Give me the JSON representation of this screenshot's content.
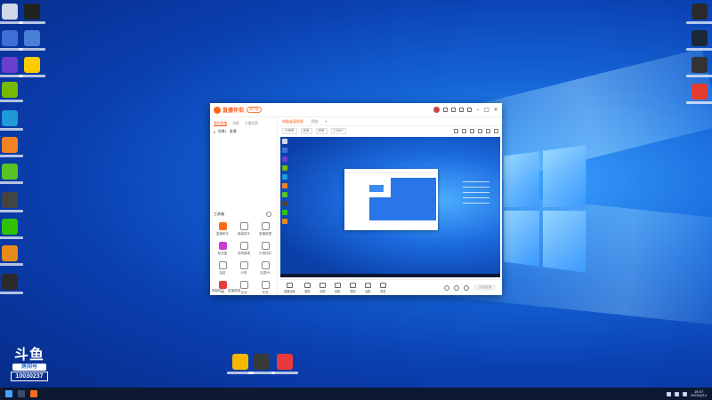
{
  "desktop": {
    "left_icons": [
      {
        "icon": "recycle-bin-icon",
        "color": "#cfd8e6"
      },
      {
        "icon": "control-panel-icon",
        "color": "#3f6fd6"
      },
      {
        "icon": "app-icon",
        "color": "#6a3fd0"
      },
      {
        "icon": "nvidia-icon",
        "color": "#76b900"
      },
      {
        "icon": "edge-icon",
        "color": "#1e9ad6"
      },
      {
        "icon": "app-icon",
        "color": "#f58220"
      },
      {
        "icon": "app-icon",
        "color": "#58c322"
      },
      {
        "icon": "app-icon",
        "color": "#444444"
      },
      {
        "icon": "wechat-icon",
        "color": "#2dc100"
      },
      {
        "icon": "app-icon",
        "color": "#e88a1a"
      },
      {
        "icon": "app-icon",
        "color": "#2a2a2a"
      }
    ],
    "second_col_icons": [
      {
        "icon": "app-icon",
        "color": "#222222"
      },
      {
        "icon": "app-icon",
        "color": "#4a7fd8"
      },
      {
        "icon": "app-icon",
        "color": "#ffcc00"
      }
    ],
    "right_icons": [
      {
        "icon": "epic-games-icon",
        "color": "#2a2a2a"
      },
      {
        "icon": "steam-icon",
        "color": "#1b2838"
      },
      {
        "icon": "app-icon",
        "color": "#333333"
      },
      {
        "icon": "app-icon",
        "color": "#e43c2f"
      }
    ],
    "bottom_icons": [
      {
        "icon": "app-icon",
        "color": "#f5b800"
      },
      {
        "icon": "app-icon",
        "color": "#3a3a3a"
      },
      {
        "icon": "app-icon",
        "color": "#e83a3a"
      }
    ]
  },
  "douyu": {
    "big": "斗鱼",
    "sub": "房间号",
    "room": "10030237"
  },
  "app": {
    "name": "直播伴侣",
    "version": "官方版",
    "sidebar_tabs": [
      "我的直播",
      "场景",
      "开播设置"
    ],
    "scene_label": "场景1",
    "scene_item": "直播",
    "tools_title": "工具箱",
    "tools": [
      {
        "label": "直播助手",
        "color": "#ff6a1a"
      },
      {
        "label": "弹幕助手",
        "color": "#888888"
      },
      {
        "label": "直播数据",
        "color": "#888888"
      },
      {
        "label": "粉丝团",
        "color": "#c53fd0"
      },
      {
        "label": "房间管理",
        "color": "#888888"
      },
      {
        "label": "礼物特效",
        "color": "#888888"
      },
      {
        "label": "抽奖",
        "color": "#888888"
      },
      {
        "label": "分享",
        "color": "#888888"
      },
      {
        "label": "连麦PK",
        "color": "#888888"
      },
      {
        "label": "PK",
        "color": "#e23c3c"
      },
      {
        "label": "互动",
        "color": "#888888"
      },
      {
        "label": "任务",
        "color": "#888888"
      }
    ],
    "footer_left": "弹幕助手",
    "footer_right": "直播数据",
    "main_tabs": [
      "电脑桌面投屏",
      "添加"
    ],
    "info_chips": [
      "分辨率",
      "帧率",
      "码率",
      "1080P"
    ],
    "bottom_tools": [
      "直播设置",
      "美颜",
      "滤镜",
      "贴纸",
      "录制",
      "连麦",
      "音效"
    ],
    "go_live_label": "开始直播"
  },
  "taskbar": {
    "time": "16:37",
    "date": "2022/4/14"
  }
}
